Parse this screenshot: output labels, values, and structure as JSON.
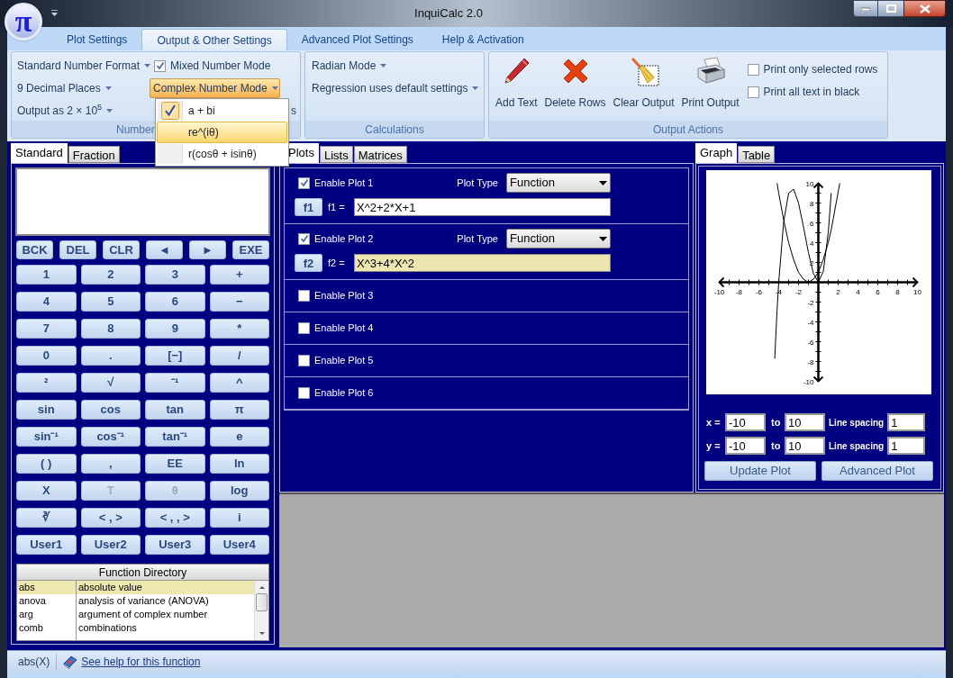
{
  "window": {
    "title": "InquiCalc 2.0",
    "app_button": "π"
  },
  "ribbon_tabs": [
    {
      "label": "Plot Settings",
      "selected": false
    },
    {
      "label": "Output & Other Settings",
      "selected": true
    },
    {
      "label": "Advanced Plot Settings",
      "selected": false
    },
    {
      "label": "Help & Activation",
      "selected": false
    }
  ],
  "number_group": {
    "label": "Number",
    "dropdowns": [
      "Standard Number Format",
      "9 Decimal Places",
      "Output as 2 × 10$^{5}$"
    ],
    "mixed_number_mode": {
      "label": "Mixed Number Mode",
      "checked": true
    },
    "complex_mode": {
      "label": "Complex Number Mode",
      "open": true
    },
    "hidden_item_tail": "s"
  },
  "complex_menu": [
    {
      "label": "a + bi",
      "checked": true,
      "highlighted": false
    },
    {
      "label": "re^(iθ)",
      "checked": false,
      "highlighted": true
    },
    {
      "label": "r(cosθ + isinθ)",
      "checked": false,
      "highlighted": false
    }
  ],
  "calculations_group": {
    "label": "Calculations",
    "dropdowns": [
      "Radian Mode",
      "Regression uses default settings"
    ]
  },
  "output_actions_group": {
    "label": "Output Actions",
    "buttons": [
      {
        "label": "Add Text",
        "kind": "pencil"
      },
      {
        "label": "Delete Rows",
        "kind": "delete"
      },
      {
        "label": "Clear Output",
        "kind": "broom"
      },
      {
        "label": "Print Output",
        "kind": "printer"
      }
    ],
    "options": [
      {
        "label": "Print only selected rows",
        "checked": false
      },
      {
        "label": "Print all text in black",
        "checked": false
      }
    ]
  },
  "calculator": {
    "tabs": [
      {
        "label": "Standard",
        "selected": true
      },
      {
        "label": "Fraction",
        "selected": false
      }
    ],
    "control_keys": [
      "BCK",
      "DEL",
      "CLR",
      "◄",
      "►",
      "EXE"
    ],
    "keys": [
      {
        "label": "1",
        "disabled": false
      },
      {
        "label": "2",
        "disabled": false
      },
      {
        "label": "3",
        "disabled": false
      },
      {
        "label": "+",
        "disabled": false
      },
      {
        "label": "4",
        "disabled": false
      },
      {
        "label": "5",
        "disabled": false
      },
      {
        "label": "6",
        "disabled": false
      },
      {
        "label": "−",
        "disabled": false
      },
      {
        "label": "7",
        "disabled": false
      },
      {
        "label": "8",
        "disabled": false
      },
      {
        "label": "9",
        "disabled": false
      },
      {
        "label": "*",
        "disabled": false
      },
      {
        "label": "0",
        "disabled": false
      },
      {
        "label": ".",
        "disabled": false
      },
      {
        "label": "[−]",
        "disabled": false
      },
      {
        "label": "/",
        "disabled": false
      },
      {
        "label": "²",
        "disabled": false
      },
      {
        "label": "√",
        "disabled": false
      },
      {
        "label": "⁻¹",
        "disabled": false
      },
      {
        "label": "^",
        "disabled": false
      },
      {
        "label": "sin",
        "disabled": false
      },
      {
        "label": "cos",
        "disabled": false
      },
      {
        "label": "tan",
        "disabled": false
      },
      {
        "label": "π",
        "disabled": false
      },
      {
        "label": "sin⁻¹",
        "disabled": false
      },
      {
        "label": "cos⁻¹",
        "disabled": false
      },
      {
        "label": "tan⁻¹",
        "disabled": false
      },
      {
        "label": "e",
        "disabled": false
      },
      {
        "label": "(   )",
        "disabled": false
      },
      {
        "label": ",",
        "disabled": false
      },
      {
        "label": "EE",
        "disabled": false
      },
      {
        "label": "ln",
        "disabled": false
      },
      {
        "label": "X",
        "disabled": false
      },
      {
        "label": "T",
        "disabled": true
      },
      {
        "label": "θ",
        "disabled": true
      },
      {
        "label": "log",
        "disabled": false
      },
      {
        "label": "∛",
        "disabled": false
      },
      {
        "label": "< , >",
        "disabled": false
      },
      {
        "label": "< , , >",
        "disabled": false
      },
      {
        "label": "i",
        "disabled": false
      },
      {
        "label": "User1",
        "disabled": false
      },
      {
        "label": "User2",
        "disabled": false
      },
      {
        "label": "User3",
        "disabled": false
      },
      {
        "label": "User4",
        "disabled": false
      }
    ]
  },
  "function_directory": {
    "title": "Function Directory",
    "rows": [
      {
        "name": "abs",
        "description": "absolute value",
        "selected": true
      },
      {
        "name": "anova",
        "description": "analysis of variance (ANOVA)",
        "selected": false
      },
      {
        "name": "arg",
        "description": "argument of complex number",
        "selected": false
      },
      {
        "name": "comb",
        "description": "combinations",
        "selected": false
      }
    ]
  },
  "plots_panel": {
    "tabs": [
      {
        "label": "Plots",
        "selected": true
      },
      {
        "label": "Lists",
        "selected": false
      },
      {
        "label": "Matrices",
        "selected": false
      }
    ],
    "plots": [
      {
        "label": "Enable Plot 1",
        "enabled": true,
        "plot_type_label": "Plot Type",
        "plot_type": "Function",
        "button": "f1",
        "equation_label": "f1 =",
        "equation": "X^2+2*X+1",
        "focused": false
      },
      {
        "label": "Enable Plot 2",
        "enabled": true,
        "plot_type_label": "Plot Type",
        "plot_type": "Function",
        "button": "f2",
        "equation_label": "f2 =",
        "equation": "X^3+4*X^2",
        "focused": true
      },
      {
        "label": "Enable Plot 3",
        "enabled": false
      },
      {
        "label": "Enable Plot 4",
        "enabled": false
      },
      {
        "label": "Enable Plot 5",
        "enabled": false
      },
      {
        "label": "Enable Plot 6",
        "enabled": false
      }
    ]
  },
  "graph_panel": {
    "tabs": [
      {
        "label": "Graph",
        "selected": true
      },
      {
        "label": "Table",
        "selected": false
      }
    ],
    "chart_data": {
      "type": "line",
      "x": [
        -4.4,
        -4.16,
        -4,
        -3.5,
        -3,
        -2.5,
        -2,
        -1.5,
        -1,
        -0.5,
        0,
        0.5,
        1,
        1.3,
        2.16
      ],
      "series": [
        {
          "color": "#000000",
          "values": [
            null,
            10,
            9,
            6.3,
            4,
            2.3,
            1,
            0.3,
            0,
            0.3,
            1,
            2.3,
            4,
            5.3,
            10
          ]
        },
        {
          "color": "#000000",
          "values": [
            -7.7,
            -2.8,
            0,
            6.1,
            9,
            9.4,
            8,
            5.6,
            3,
            0.9,
            0,
            1.1,
            5,
            9,
            null
          ]
        }
      ],
      "xlim": [
        -10,
        10
      ],
      "ylim": [
        -10,
        10
      ],
      "xticks": [
        -10,
        -8,
        -6,
        -4,
        -2,
        2,
        4,
        6,
        8,
        10
      ],
      "yticks": [
        -10,
        -8,
        -6,
        -4,
        -2,
        2,
        4,
        6,
        8,
        10
      ]
    },
    "ranges": [
      {
        "axis_label": "x =",
        "from": "-10",
        "to_label": "to",
        "to": "10",
        "spacing_label": "Line spacing",
        "spacing": "1"
      },
      {
        "axis_label": "y =",
        "from": "-10",
        "to_label": "to",
        "to": "10",
        "spacing_label": "Line spacing",
        "spacing": "1"
      }
    ],
    "buttons": [
      "Update Plot",
      "Advanced Plot"
    ]
  },
  "status_bar": {
    "function": "abs(X)",
    "help_link": "See help for this function"
  }
}
